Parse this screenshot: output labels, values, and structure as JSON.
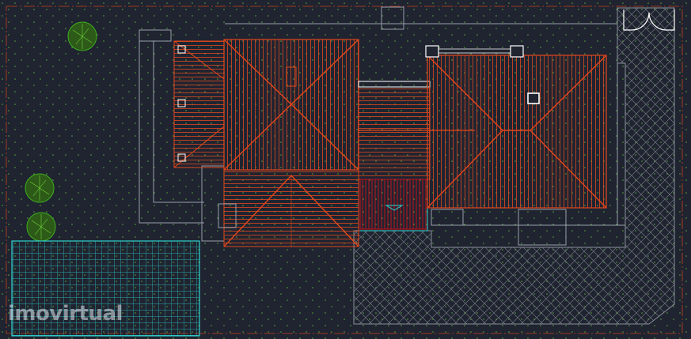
{
  "watermark": {
    "text": "imovirtual"
  },
  "colors": {
    "background": "#1f2430",
    "roof_lines": "#e2471c",
    "roof_fill": "#4a2a22",
    "roof_accent": "#c0121e",
    "walls": "#9aa0aa",
    "paving": "#8a8f98",
    "pool": "#2fd3d0",
    "trees": "#3fae1e",
    "boundary": "#c8401c",
    "grass_dots": "#5aa83a"
  },
  "icons": [
    "tree-icon",
    "pool-grid",
    "paving-hatch",
    "hip-roof"
  ]
}
